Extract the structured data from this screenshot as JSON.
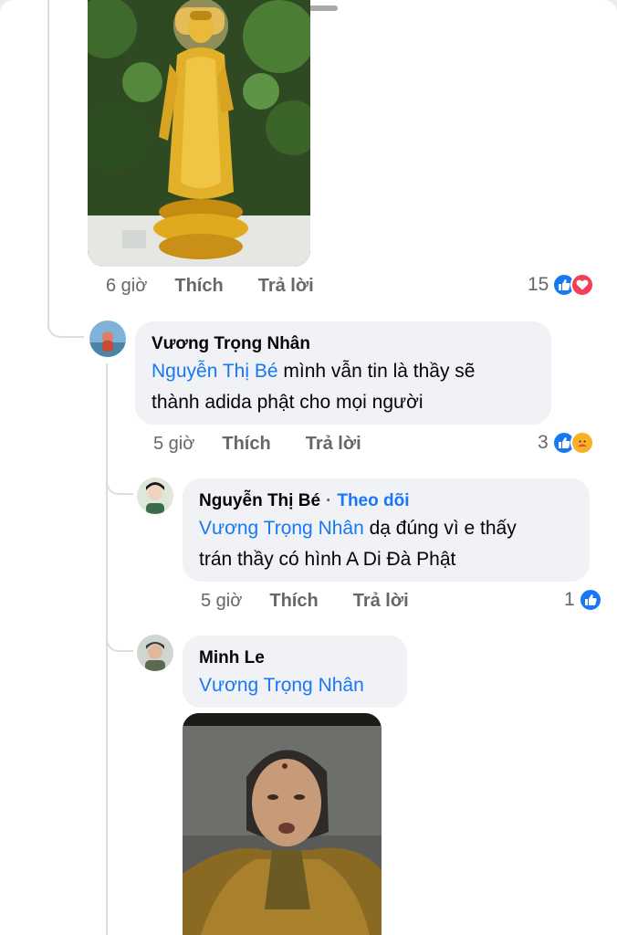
{
  "icons": {
    "like": "thumbs-up-icon",
    "love": "heart-icon",
    "care": "care-face-icon"
  },
  "colors": {
    "link": "#1877f2",
    "bubble": "#f0f2f5",
    "meta": "#65676b",
    "love": "#f33e58"
  },
  "comments": [
    {
      "time": "6 giờ",
      "like_label": "Thích",
      "reply_label": "Trả lời",
      "reaction_count": "15"
    },
    {
      "author": "Vương Trọng Nhân",
      "mention": "Nguyễn Thị Bé",
      "text_line1": " mình vẫn tin là thầy sẽ",
      "text_line2": "thành adida phật cho mọi người",
      "time": "5 giờ",
      "like_label": "Thích",
      "reply_label": "Trả lời",
      "reaction_count": "3"
    },
    {
      "author": "Nguyễn Thị Bé",
      "separator": "·",
      "follow_label": "Theo dõi",
      "mention": "Vương Trọng Nhân",
      "text_line1": " dạ đúng vì e thấy",
      "text_line2": "trán thầy có hình A Di Đà Phật",
      "time": "5 giờ",
      "like_label": "Thích",
      "reply_label": "Trả lời",
      "reaction_count": "1"
    },
    {
      "author": "Minh Le",
      "mention": "Vương Trọng Nhân"
    }
  ]
}
